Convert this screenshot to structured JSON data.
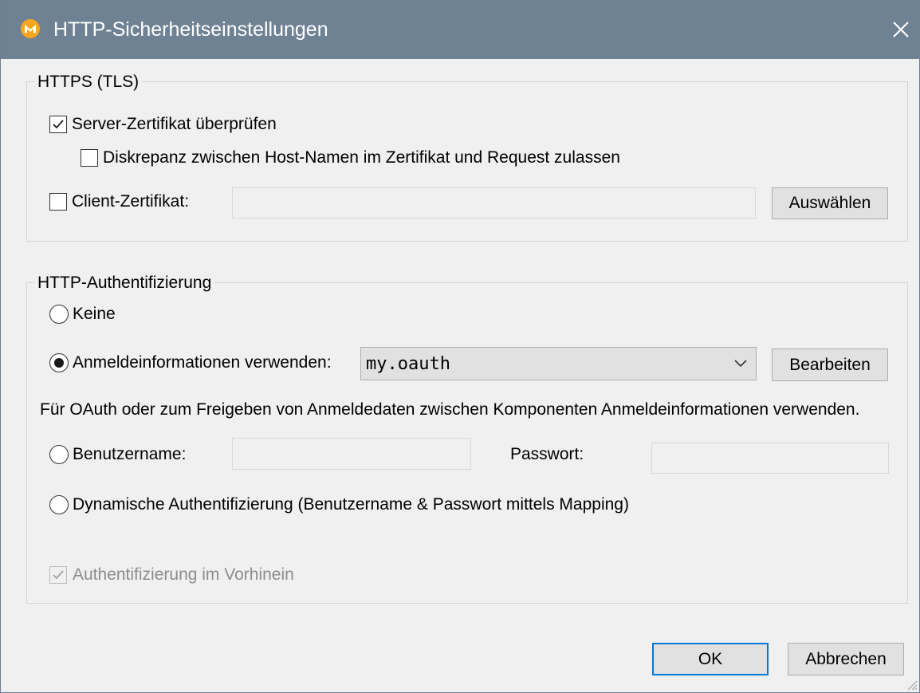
{
  "window": {
    "title": "HTTP-Sicherheitseinstellungen",
    "titlebar_color": "#6f8294",
    "app_icon": "mapforce-logo-icon",
    "close_icon": "close-icon"
  },
  "https": {
    "group_label": "HTTPS (TLS)",
    "verify_server_cert": {
      "label": "Server-Zertifikat überprüfen",
      "checked": true
    },
    "allow_host_mismatch": {
      "label": "Diskrepanz zwischen Host-Namen im Zertifikat und Request zulassen",
      "checked": false
    },
    "client_cert": {
      "label": "Client-Zertifikat:",
      "checked": false,
      "value": ""
    },
    "choose_button": "Auswählen"
  },
  "auth": {
    "group_label": "HTTP-Authentifizierung",
    "none_label": "Keine",
    "use_credentials_label": "Anmeldeinformationen verwenden:",
    "credential_selected": "my.oauth",
    "edit_button": "Bearbeiten",
    "hint": "Für OAuth oder zum Freigeben von Anmeldedaten zwischen Komponenten Anmeldeinformationen verwenden.",
    "username_label": "Benutzername:",
    "username_value": "",
    "password_label": "Passwort:",
    "password_value": "",
    "dynamic_label": "Dynamische Authentifizierung (Benutzername & Passwort mittels Mapping)",
    "selected_option": "use_credentials",
    "preemptive": {
      "label": "Authentifizierung im Vorhinein",
      "checked": true,
      "disabled": true
    }
  },
  "footer": {
    "ok_button": "OK",
    "cancel_button": "Abbrechen"
  },
  "colors": {
    "dialog_bg": "#f0f0f0",
    "default_button_border": "#0078d7"
  }
}
